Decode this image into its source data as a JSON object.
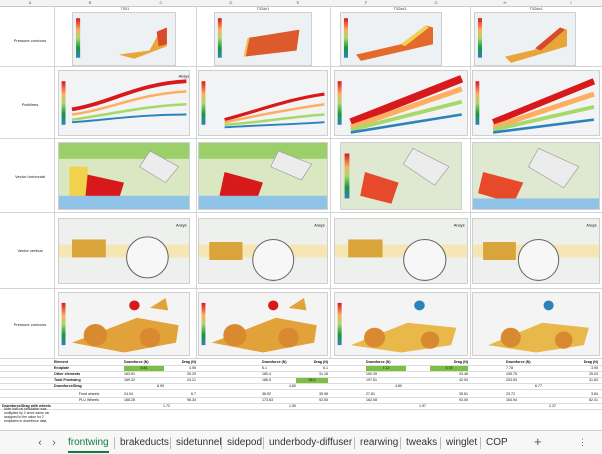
{
  "columns": [
    "A",
    "B",
    "C",
    "D",
    "E",
    "F",
    "G",
    "H",
    "I"
  ],
  "config_headers": [
    "TS01",
    "TS2#c1",
    "TS2#c3",
    "TS2#c4"
  ],
  "row_labels": [
    "Pressure contours",
    "Pathlines",
    "Vector horizontal",
    "Vector vertical",
    "Pressure contours"
  ],
  "watermark": "Ansys",
  "table": {
    "header": {
      "element": "Element",
      "downforce": "Downforce (N)",
      "drag": "Drag (N)"
    },
    "rows": [
      {
        "label": "Endplate",
        "vals": [
          "5.81",
          "4.95",
          "6.1",
          "6.1",
          "7.12",
          "5.78",
          "7.78",
          "3.95"
        ]
      },
      {
        "label": "Other elements",
        "vals": [
          "163.51",
          "39.29",
          "180.4",
          "31.16",
          "190.39",
          "33.46",
          "195.75",
          "25.03"
        ]
      },
      {
        "label": "Total Frontwing",
        "vals": [
          "169.32",
          "24.21",
          "186.5",
          "38.9",
          "197.51",
          "42.93",
          "203.53",
          "31.63"
        ]
      },
      {
        "label": "Downforce/Drag",
        "vals": [
          "6.99",
          "",
          "4.80",
          "",
          "4.60",
          "",
          "6.77",
          ""
        ]
      }
    ],
    "lower_rows": [
      {
        "label": "Front wheels",
        "vals": [
          "24.04",
          "6.7",
          "36.92",
          "35.98",
          "27.81",
          "35.81",
          "23.72",
          "3.84"
        ]
      },
      {
        "label": "PLU Wheels",
        "vals": [
          "168.28",
          "98.34",
          "173.63",
          "92.55",
          "162.08",
          "93.05",
          "164.94",
          "82.01"
        ]
      },
      {
        "label": "Downforce/Drag with wheels",
        "vals": [
          "",
          "1.72",
          "",
          "1.90",
          "",
          "1.97",
          "",
          "2.37"
        ]
      }
    ],
    "note": "Note half car simulation was multiplied by 2 since same car assigned to the value for 2 endplates in downforce data"
  },
  "tabs": [
    "frontwing",
    "brakeducts",
    "sidetunnel",
    "sidepod",
    "underbody-diffuser",
    "rearwing",
    "tweaks",
    "winglet",
    "COP"
  ],
  "active_tab": "frontwing",
  "add_tab_label": "+",
  "nav_prev": "‹",
  "nav_next": "›",
  "colors": {
    "active_tab": "#107c41",
    "highlight": "#7ac143"
  }
}
